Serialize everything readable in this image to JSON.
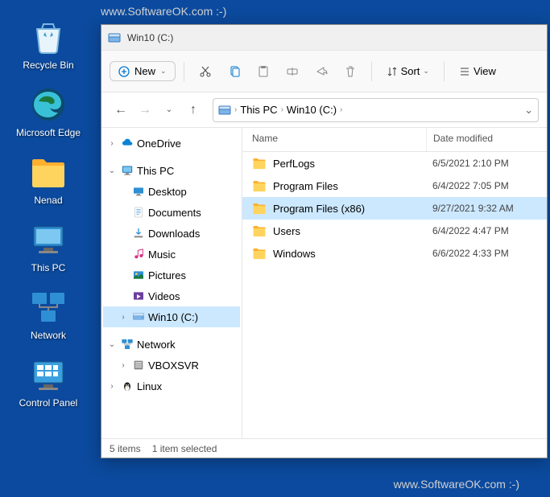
{
  "watermark": "www.SoftwareOK.com :-)",
  "desktop": [
    {
      "label": "Recycle Bin",
      "icon": "recycle"
    },
    {
      "label": "Microsoft Edge",
      "icon": "edge"
    },
    {
      "label": "Nenad",
      "icon": "folder"
    },
    {
      "label": "This PC",
      "icon": "thispc"
    },
    {
      "label": "Network",
      "icon": "network"
    },
    {
      "label": "Control Panel",
      "icon": "cpanel"
    }
  ],
  "window": {
    "title": "Win10 (C:)"
  },
  "toolbar": {
    "new_label": "New",
    "sort_label": "Sort",
    "view_label": "View"
  },
  "breadcrumb": {
    "parts": [
      "This PC",
      "Win10 (C:)"
    ]
  },
  "tree": [
    {
      "label": "OneDrive",
      "icon": "cloud",
      "chev": "›",
      "indent": ""
    },
    {
      "label": "This PC",
      "icon": "thispc",
      "chev": "⌄",
      "indent": ""
    },
    {
      "label": "Desktop",
      "icon": "desktop",
      "chev": "",
      "indent": "indent1"
    },
    {
      "label": "Documents",
      "icon": "docs",
      "chev": "",
      "indent": "indent1"
    },
    {
      "label": "Downloads",
      "icon": "downloads",
      "chev": "",
      "indent": "indent1"
    },
    {
      "label": "Music",
      "icon": "music",
      "chev": "",
      "indent": "indent1"
    },
    {
      "label": "Pictures",
      "icon": "pictures",
      "chev": "",
      "indent": "indent1"
    },
    {
      "label": "Videos",
      "icon": "videos",
      "chev": "",
      "indent": "indent1"
    },
    {
      "label": "Win10 (C:)",
      "icon": "drive",
      "chev": "›",
      "indent": "indent1",
      "selected": true
    },
    {
      "label": "Network",
      "icon": "network",
      "chev": "⌄",
      "indent": ""
    },
    {
      "label": "VBOXSVR",
      "icon": "server",
      "chev": "›",
      "indent": "indent1"
    },
    {
      "label": "Linux",
      "icon": "linux",
      "chev": "›",
      "indent": ""
    }
  ],
  "columns": {
    "name": "Name",
    "date": "Date modified"
  },
  "files": [
    {
      "name": "PerfLogs",
      "date": "6/5/2021 2:10 PM",
      "selected": false
    },
    {
      "name": "Program Files",
      "date": "6/4/2022 7:05 PM",
      "selected": false
    },
    {
      "name": "Program Files (x86)",
      "date": "9/27/2021 9:32 AM",
      "selected": true
    },
    {
      "name": "Users",
      "date": "6/4/2022 4:47 PM",
      "selected": false
    },
    {
      "name": "Windows",
      "date": "6/6/2022 4:33 PM",
      "selected": false
    }
  ],
  "status": {
    "count": "5 items",
    "selected": "1 item selected"
  }
}
